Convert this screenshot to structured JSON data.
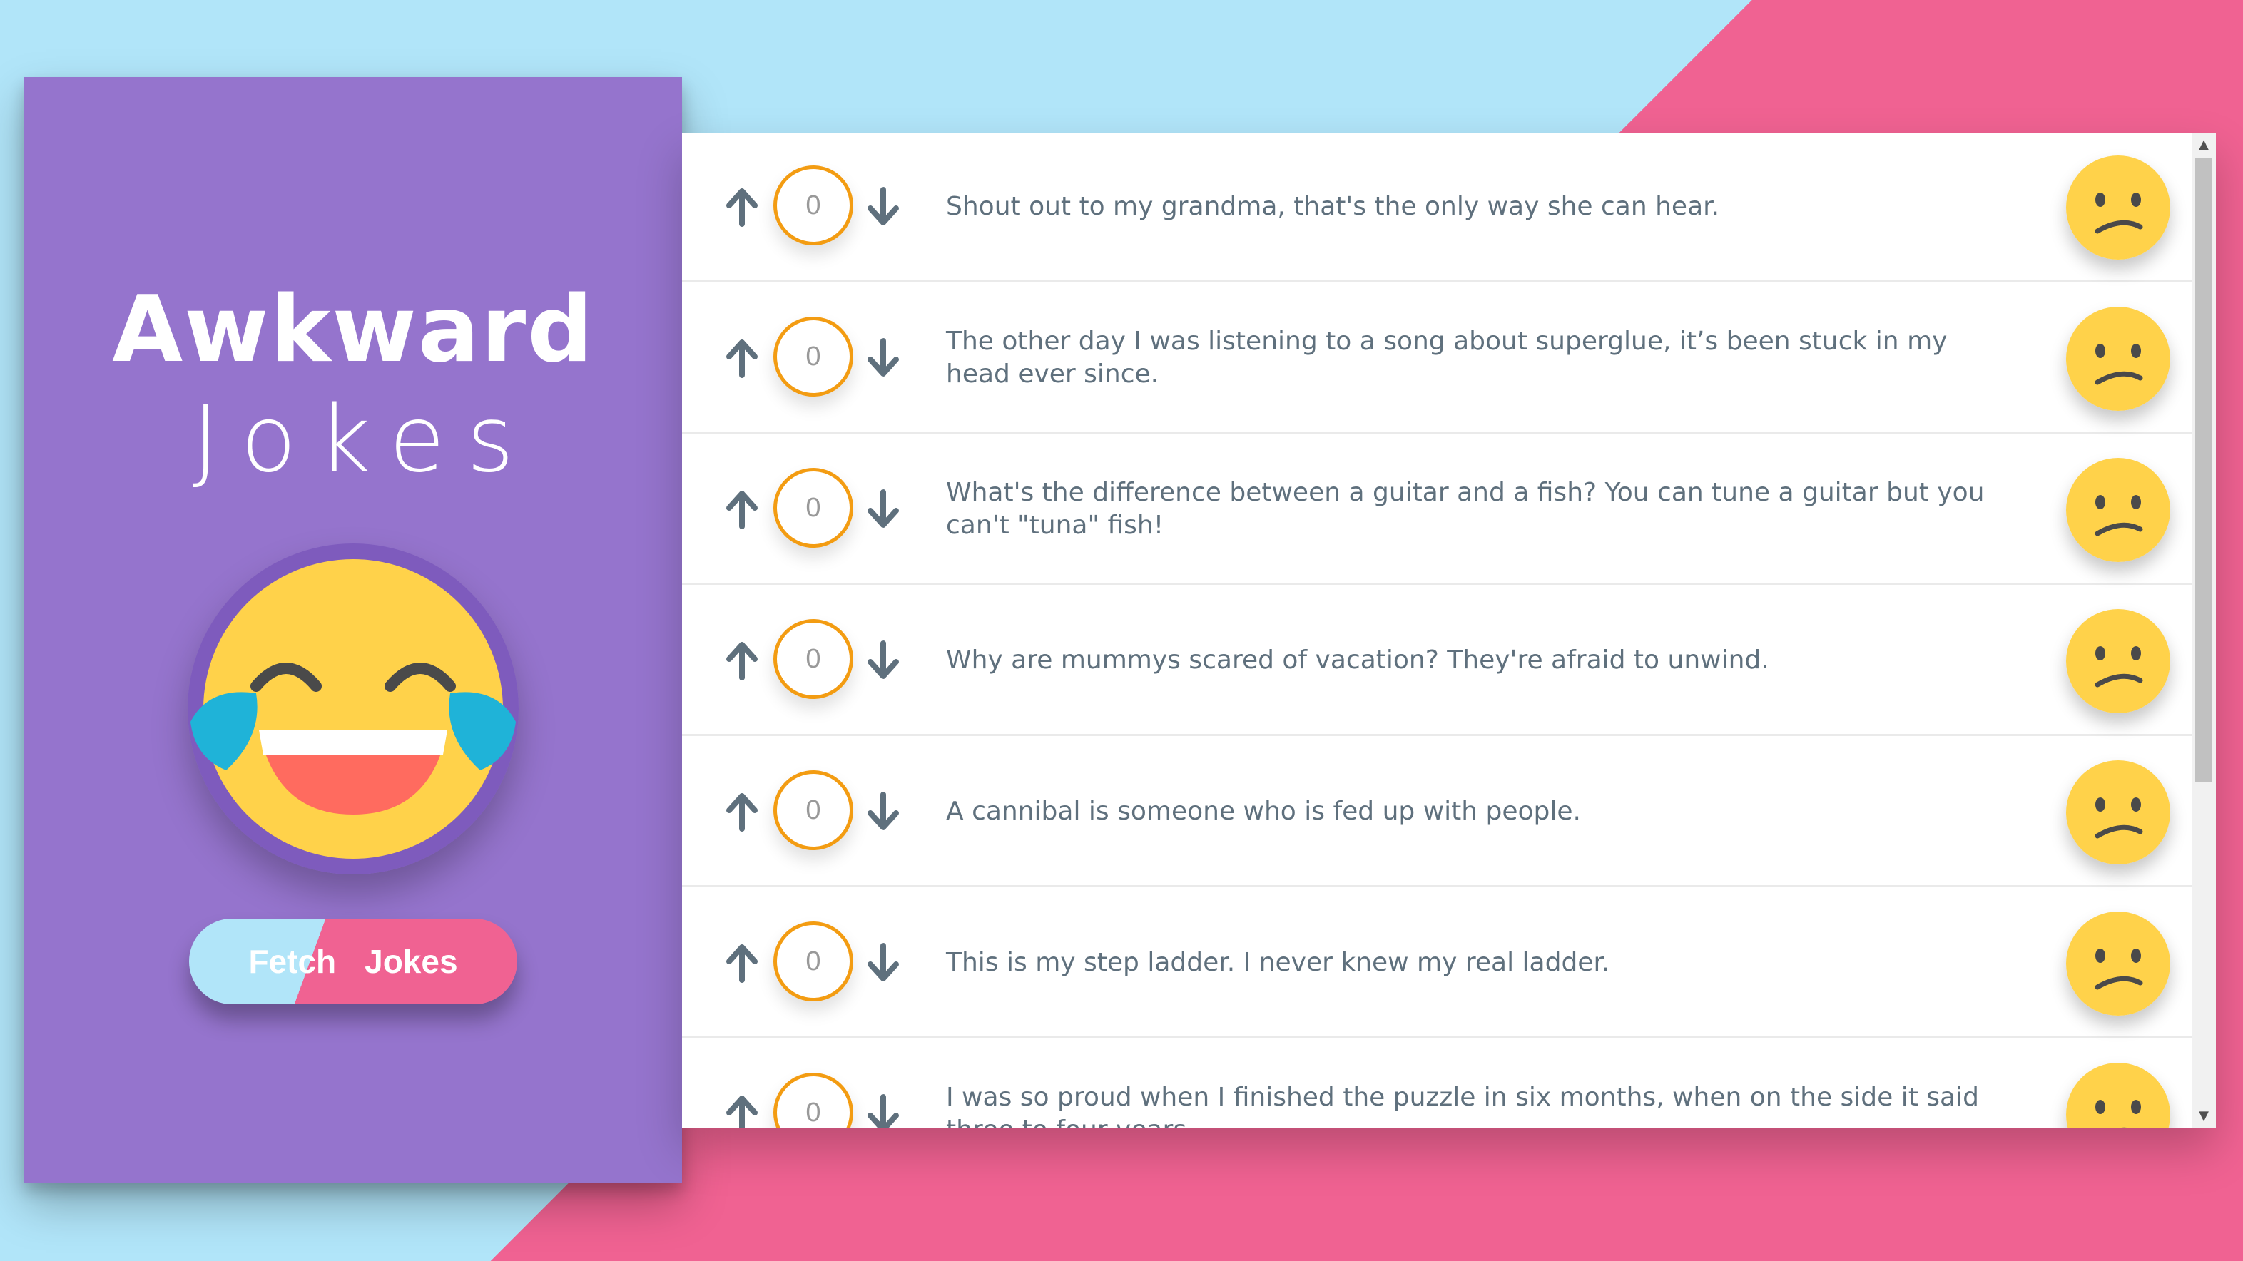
{
  "sidebar": {
    "title_main": "Awkward",
    "title_sub": "Jokes",
    "emoji_icon": "face-with-tears-of-joy-icon",
    "fetch_button": {
      "part1": "Fetch",
      "part2": "Jokes"
    }
  },
  "colors": {
    "sidebar_bg": "#9574cd",
    "bg_light_blue": "#b1e5f9",
    "bg_pink": "#f06292",
    "vote_ring": "#f39c12",
    "emoji_yellow": "#ffd24a"
  },
  "jokes": [
    {
      "votes": "0",
      "text": "Shout out to my grandma, that's the only way she can hear.",
      "reaction_icon": "confused-face-icon"
    },
    {
      "votes": "0",
      "text": "The other day I was listening to a song about superglue, it’s been stuck in my head ever since.",
      "reaction_icon": "confused-face-icon"
    },
    {
      "votes": "0",
      "text": "What's the difference between a guitar and a fish? You can tune a guitar but you can't \"tuna\" fish!",
      "reaction_icon": "confused-face-icon"
    },
    {
      "votes": "0",
      "text": "Why are mummys scared of vacation? They're afraid to unwind.",
      "reaction_icon": "confused-face-icon"
    },
    {
      "votes": "0",
      "text": "A cannibal is someone who is fed up with people.",
      "reaction_icon": "confused-face-icon"
    },
    {
      "votes": "0",
      "text": "This is my step ladder. I never knew my real ladder.",
      "reaction_icon": "confused-face-icon"
    },
    {
      "votes": "0",
      "text": "I was so proud when I finished the puzzle in six months, when on the side it said three to four years.",
      "reaction_icon": "confused-face-icon"
    }
  ]
}
